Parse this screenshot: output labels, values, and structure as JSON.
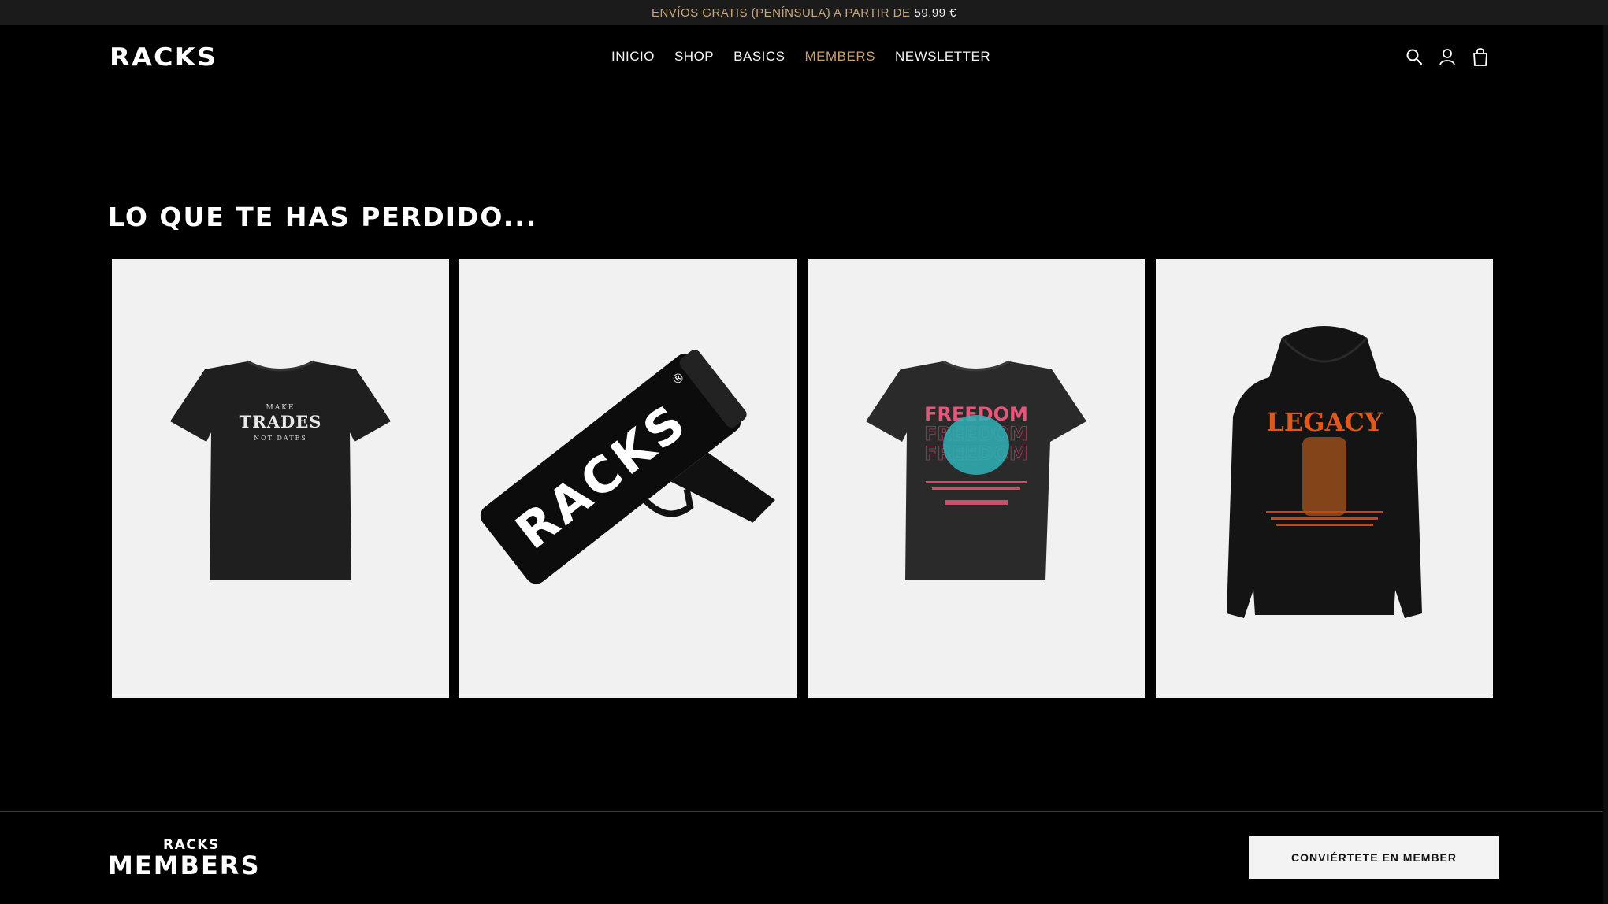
{
  "announcement": {
    "text": "ENVÍOS GRATIS (PENÍNSULA) A PARTIR DE",
    "price": "59.99 €"
  },
  "header": {
    "logo": "RACKS",
    "nav": [
      {
        "label": "INICIO",
        "active": false
      },
      {
        "label": "SHOP",
        "active": false
      },
      {
        "label": "BASICS",
        "active": false
      },
      {
        "label": "MEMBERS",
        "active": true
      },
      {
        "label": "NEWSLETTER",
        "active": false
      }
    ],
    "icons": [
      "search-icon",
      "account-icon",
      "cart-icon"
    ]
  },
  "section": {
    "title": "LO QUE TE HAS PERDIDO..."
  },
  "products": [
    {
      "type": "tshirt",
      "print_lines": [
        "MAKE",
        "TRADES",
        "NOT DATES"
      ]
    },
    {
      "type": "money-gun",
      "print_lines": [
        "RACKS",
        "®"
      ]
    },
    {
      "type": "tshirt",
      "print_lines": [
        "FREEDOM"
      ]
    },
    {
      "type": "hoodie",
      "print_lines": [
        "LEGACY"
      ]
    }
  ],
  "footer": {
    "brand_small": "RACKS",
    "brand_big": "MEMBERS",
    "cta_label": "CONVIÉRTETE EN MEMBER"
  },
  "colors": {
    "accent": "#c8a070",
    "background": "#000000",
    "card": "#f1f1f1"
  }
}
